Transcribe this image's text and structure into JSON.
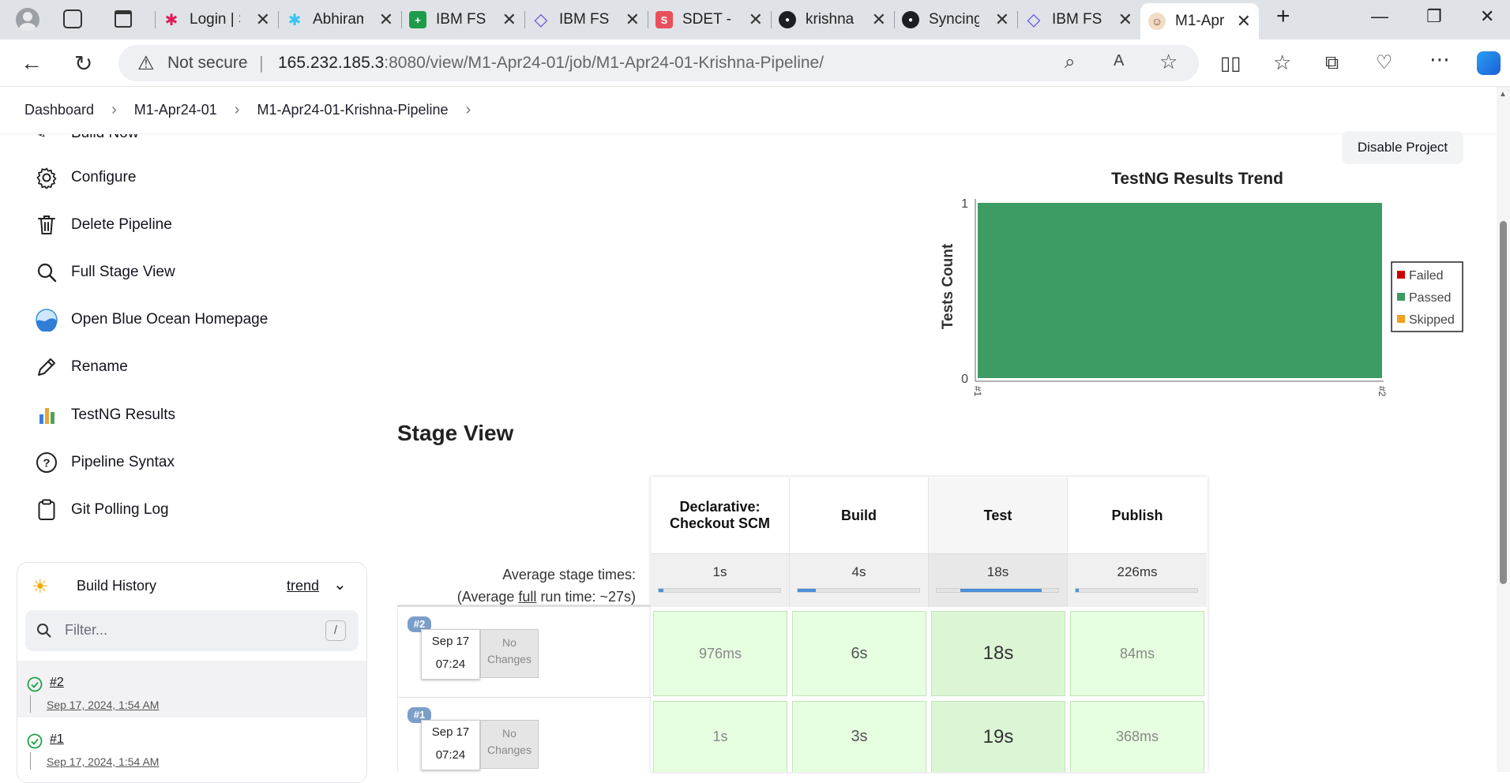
{
  "browser": {
    "tabs": [
      {
        "label": "Login | S",
        "fav_color": "#e7e7e7",
        "fav_glyph": "✱"
      },
      {
        "label": "Abhiram",
        "fav_color": "#e7e7e7",
        "fav_glyph": "✱"
      },
      {
        "label": "IBM FST",
        "fav_color": "#1e9a4b",
        "fav_glyph": "+"
      },
      {
        "label": "IBM FST",
        "fav_color": "#ffffff",
        "fav_glyph": "◇"
      },
      {
        "label": "SDET - J",
        "fav_color": "#e8505b",
        "fav_glyph": "S"
      },
      {
        "label": "krishna",
        "fav_color": "#ffffff",
        "fav_glyph": "●"
      },
      {
        "label": "Syncing",
        "fav_color": "#ffffff",
        "fav_glyph": "●"
      },
      {
        "label": "IBM FST",
        "fav_color": "#ffffff",
        "fav_glyph": "◇"
      },
      {
        "label": "M1-Apr",
        "fav_color": "#ffffff",
        "fav_glyph": "☺"
      }
    ],
    "not_secure": "Not secure",
    "url_host": "165.232.185.3",
    "url_rest": ":8080/view/M1-Apr24-01/job/M1-Apr24-01-Krishna-Pipeline/"
  },
  "breadcrumb": {
    "items": [
      "Dashboard",
      "M1-Apr24-01",
      "M1-Apr24-01-Krishna-Pipeline"
    ]
  },
  "sidebar": {
    "partial_item": "Build Now",
    "items": [
      {
        "label": "Configure",
        "icon": "gear-icon"
      },
      {
        "label": "Delete Pipeline",
        "icon": "trash-icon"
      },
      {
        "label": "Full Stage View",
        "icon": "search-icon"
      },
      {
        "label": "Open Blue Ocean Homepage",
        "icon": "blue-ocean-icon"
      },
      {
        "label": "Rename",
        "icon": "pencil-icon"
      },
      {
        "label": "TestNG Results",
        "icon": "bar-chart-icon"
      },
      {
        "label": "Pipeline Syntax",
        "icon": "help-icon"
      },
      {
        "label": "Git Polling Log",
        "icon": "clipboard-icon"
      }
    ]
  },
  "build_history": {
    "title": "Build History",
    "trend": "trend",
    "filter_placeholder": "Filter...",
    "shortcut": "/",
    "builds": [
      {
        "number": "#2",
        "date": "Sep 17, 2024, 1:54 AM",
        "status": "success"
      },
      {
        "number": "#1",
        "date": "Sep 17, 2024, 1:54 AM",
        "status": "success"
      }
    ]
  },
  "actions": {
    "disable_project": "Disable Project"
  },
  "chart_data": {
    "type": "area",
    "title": "TestNG Results Trend",
    "ylabel": "Tests Count",
    "xlabel": "",
    "x": [
      "#1",
      "#2"
    ],
    "ylim": [
      0,
      1
    ],
    "yticks": [
      "0",
      "1"
    ],
    "series": [
      {
        "name": "Failed",
        "values": [
          0,
          0
        ],
        "color": "#cc0000"
      },
      {
        "name": "Passed",
        "values": [
          1,
          1
        ],
        "color": "#3e9b63"
      },
      {
        "name": "Skipped",
        "values": [
          0,
          0
        ],
        "color": "#f0a020"
      }
    ],
    "legend": "right"
  },
  "stage_view": {
    "title": "Stage View",
    "avg_label": "Average stage times:",
    "avg_full_pre": "(Average ",
    "avg_full_link": "full",
    "avg_full_post": " run time: ~27s)",
    "stages": [
      {
        "name_line1": "Declarative:",
        "name_line2": "Checkout SCM",
        "avg": "1s",
        "avg_fraction": 0.04
      },
      {
        "name_line1": "Build",
        "name_line2": "",
        "avg": "4s",
        "avg_fraction": 0.15
      },
      {
        "name_line1": "Test",
        "name_line2": "",
        "avg": "18s",
        "avg_fraction": 0.67
      },
      {
        "name_line1": "Publish",
        "name_line2": "",
        "avg": "226ms",
        "avg_fraction": 0.01
      }
    ],
    "runs": [
      {
        "badge": "#2",
        "date": "Sep 17",
        "time": "07:24",
        "changes_line1": "No",
        "changes_line2": "Changes",
        "times": [
          "976ms",
          "6s",
          "18s",
          "84ms"
        ]
      },
      {
        "badge": "#1",
        "date": "Sep 17",
        "time": "07:24",
        "changes_line1": "No",
        "changes_line2": "Changes",
        "times": [
          "1s",
          "3s",
          "19s",
          "368ms"
        ]
      }
    ]
  }
}
